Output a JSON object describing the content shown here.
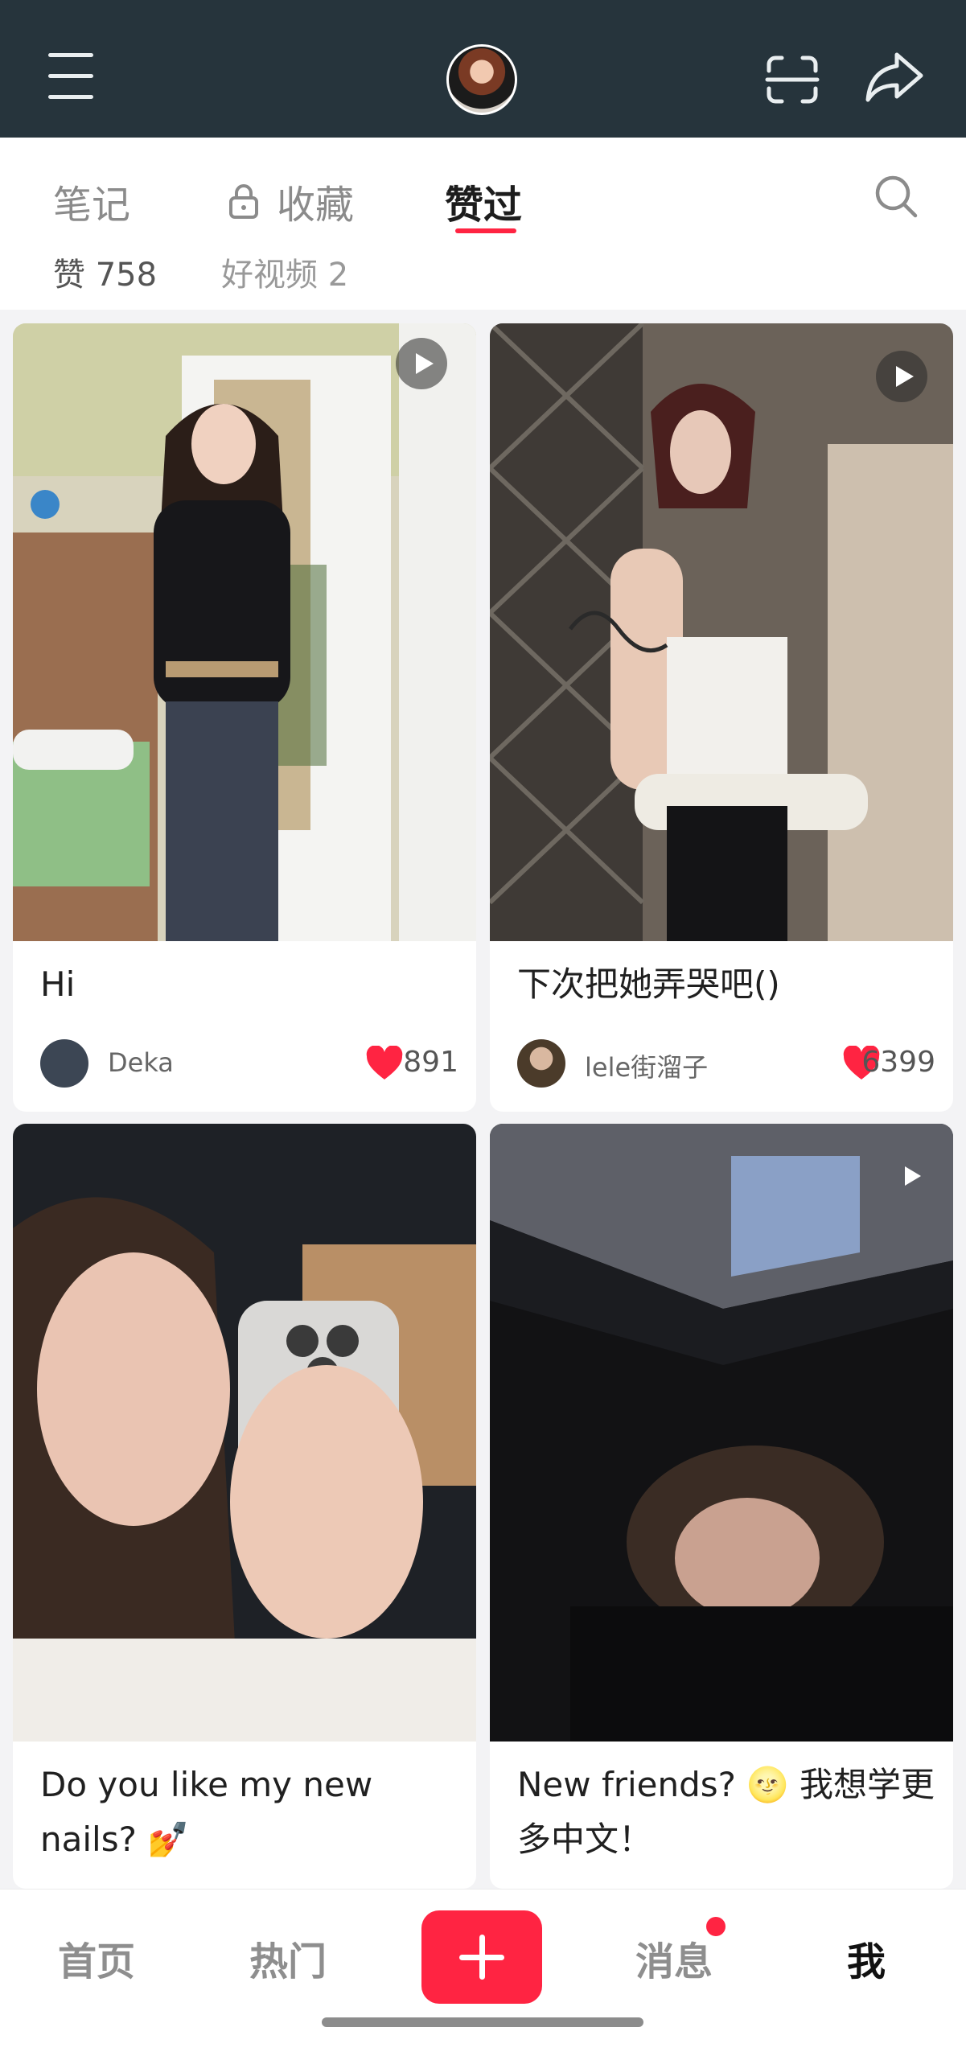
{
  "header": {
    "menu_icon": "hamburger-menu-icon",
    "avatar_icon": "profile-avatar",
    "scan_icon": "scan-icon",
    "share_icon": "share-icon",
    "colors": {
      "bar": "#26343c",
      "accent": "#ff2442"
    }
  },
  "tabs": [
    {
      "label": "笔记",
      "active": false
    },
    {
      "label": "收藏",
      "active": false,
      "icon": "lock-icon"
    },
    {
      "label": "赞过",
      "active": true
    }
  ],
  "search_icon": "search-icon",
  "stats": {
    "likes_text": "赞 758",
    "videos_text": "好视频 2"
  },
  "cards": [
    {
      "title": "Hi",
      "author": "Deka",
      "likes": "891",
      "video": true
    },
    {
      "title": "下次把她弄哭吧()",
      "author": "lele街溜子",
      "likes": "6399",
      "video": true
    },
    {
      "title": "Do you like my new nails? 💅",
      "author": "",
      "likes": "",
      "video": false
    },
    {
      "title": "New friends? 🌝 我想学更多中文！",
      "author": "",
      "likes": "",
      "video": true
    }
  ],
  "bottom_nav": {
    "home": "首页",
    "hot": "热门",
    "add_icon": "plus-icon",
    "messages": "消息",
    "messages_badge": true,
    "me": "我"
  }
}
